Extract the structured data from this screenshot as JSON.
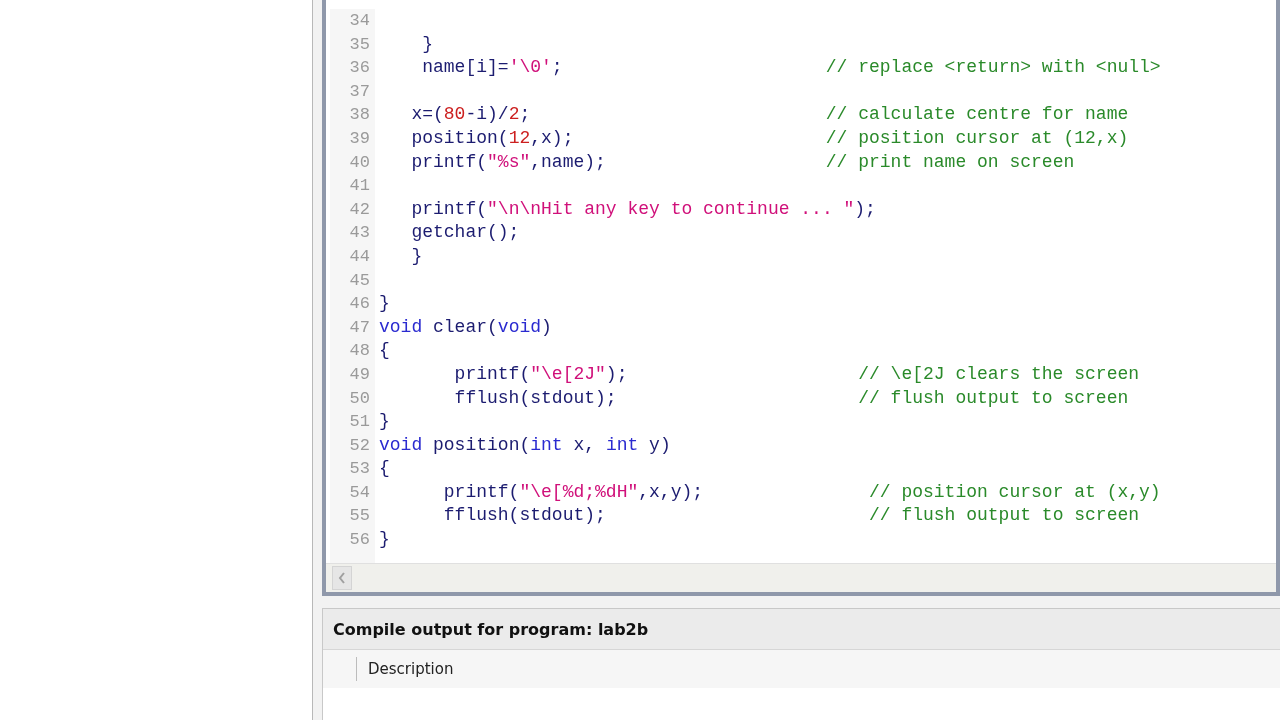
{
  "editor": {
    "lines": [
      {
        "number": "34"
      },
      {
        "number": "35",
        "tokens": [
          {
            "kind": "plain",
            "text": "    }"
          }
        ]
      },
      {
        "number": "36",
        "tokens": [
          {
            "kind": "plain",
            "text": "    name[i]="
          },
          {
            "kind": "string",
            "text": "'\\0'"
          },
          {
            "kind": "plain",
            "text": ";"
          }
        ],
        "comment": "// replace <return> with <null>"
      },
      {
        "number": "37"
      },
      {
        "number": "38",
        "tokens": [
          {
            "kind": "plain",
            "text": "   x=("
          },
          {
            "kind": "number",
            "text": "80"
          },
          {
            "kind": "plain",
            "text": "-i)/"
          },
          {
            "kind": "number",
            "text": "2"
          },
          {
            "kind": "plain",
            "text": ";"
          }
        ],
        "comment": "// calculate centre for name"
      },
      {
        "number": "39",
        "tokens": [
          {
            "kind": "plain",
            "text": "   position("
          },
          {
            "kind": "number",
            "text": "12"
          },
          {
            "kind": "plain",
            "text": ",x);"
          }
        ],
        "comment": "// position cursor at (12,x)"
      },
      {
        "number": "40",
        "tokens": [
          {
            "kind": "plain",
            "text": "   printf("
          },
          {
            "kind": "string",
            "text": "\"%s\""
          },
          {
            "kind": "plain",
            "text": ",name);"
          }
        ],
        "comment": "// print name on screen"
      },
      {
        "number": "41"
      },
      {
        "number": "42",
        "tokens": [
          {
            "kind": "plain",
            "text": "   printf("
          },
          {
            "kind": "string",
            "text": "\"\\n\\nHit any key to continue ... \""
          },
          {
            "kind": "plain",
            "text": ");"
          }
        ]
      },
      {
        "number": "43",
        "tokens": [
          {
            "kind": "plain",
            "text": "   getchar();"
          }
        ]
      },
      {
        "number": "44",
        "tokens": [
          {
            "kind": "plain",
            "text": "   }"
          }
        ]
      },
      {
        "number": "45"
      },
      {
        "number": "46",
        "tokens": [
          {
            "kind": "plain",
            "text": "}"
          }
        ]
      },
      {
        "number": "47",
        "tokens": [
          {
            "kind": "keyword",
            "text": "void"
          },
          {
            "kind": "plain",
            "text": " clear("
          },
          {
            "kind": "keyword",
            "text": "void"
          },
          {
            "kind": "plain",
            "text": ")"
          }
        ]
      },
      {
        "number": "48",
        "tokens": [
          {
            "kind": "plain",
            "text": "{"
          }
        ]
      },
      {
        "number": "49",
        "tokens": [
          {
            "kind": "plain",
            "text": "       printf("
          },
          {
            "kind": "string",
            "text": "\"\\e[2J\""
          },
          {
            "kind": "plain",
            "text": ");"
          }
        ],
        "comment": "// \\e[2J clears the screen"
      },
      {
        "number": "50",
        "tokens": [
          {
            "kind": "plain",
            "text": "       fflush(stdout);"
          }
        ],
        "comment": "// flush output to screen"
      },
      {
        "number": "51",
        "tokens": [
          {
            "kind": "plain",
            "text": "}"
          }
        ]
      },
      {
        "number": "52",
        "tokens": [
          {
            "kind": "keyword",
            "text": "void"
          },
          {
            "kind": "plain",
            "text": " position("
          },
          {
            "kind": "keyword",
            "text": "int"
          },
          {
            "kind": "plain",
            "text": " x, "
          },
          {
            "kind": "keyword",
            "text": "int"
          },
          {
            "kind": "plain",
            "text": " y)"
          }
        ]
      },
      {
        "number": "53",
        "tokens": [
          {
            "kind": "plain",
            "text": "{"
          }
        ]
      },
      {
        "number": "54",
        "tokens": [
          {
            "kind": "plain",
            "text": "      printf("
          },
          {
            "kind": "string",
            "text": "\"\\e[%d;%dH\""
          },
          {
            "kind": "plain",
            "text": ",x,y);"
          }
        ],
        "comment": "// position cursor at (x,y)"
      },
      {
        "number": "55",
        "tokens": [
          {
            "kind": "plain",
            "text": "      fflush(stdout);"
          }
        ],
        "comment": "// flush output to screen"
      },
      {
        "number": "56",
        "tokens": [
          {
            "kind": "plain",
            "text": "}"
          }
        ]
      }
    ]
  },
  "output_panel": {
    "title": "Compile output for program: lab2b",
    "columns": [
      "Description"
    ]
  }
}
